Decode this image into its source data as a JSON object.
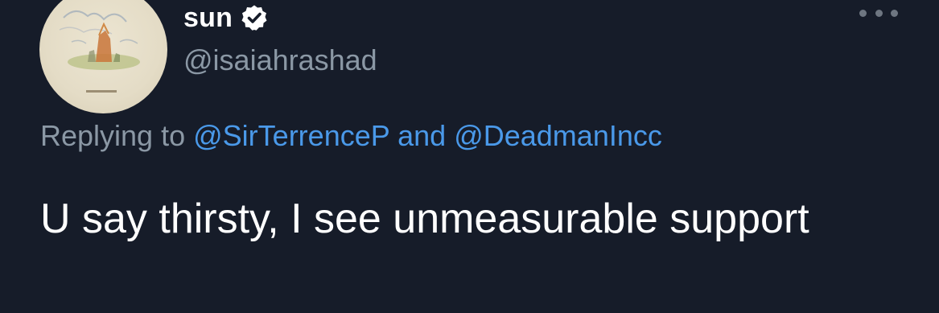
{
  "tweet": {
    "display_name": "sun",
    "handle": "@isaiahrashad",
    "verified": true,
    "reply": {
      "prefix": "Replying to",
      "mention_1": "@SirTerrenceP",
      "conjunction": "and",
      "mention_2": "@DeadmanIncc"
    },
    "text": "U say thirsty, I see unmeasurable support",
    "avatar_icon": "sketch-avatar",
    "more_icon": "more-dots-icon"
  },
  "colors": {
    "background": "#161c29",
    "secondary_text": "#8b98a5",
    "link": "#4a99e9",
    "primary_text": "#ffffff"
  }
}
